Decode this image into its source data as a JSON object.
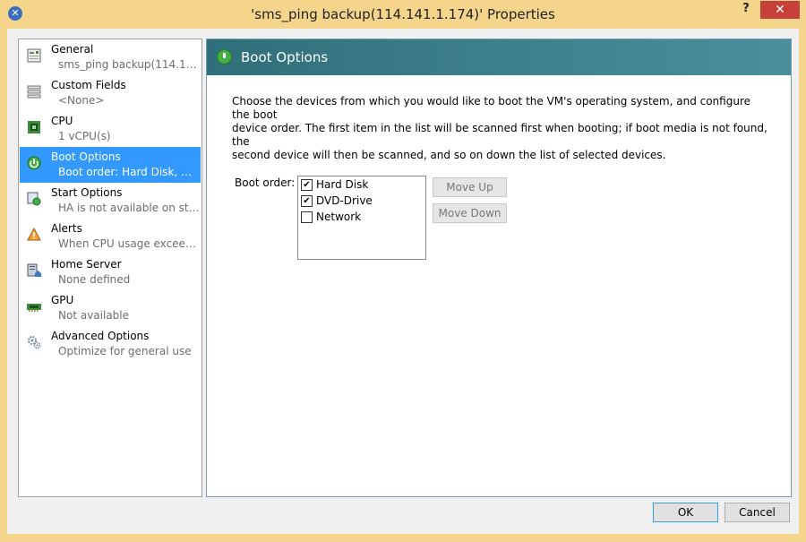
{
  "window": {
    "title": "'sms_ping backup(114.141.1.174)' Properties",
    "help_label": "?",
    "close_label": "✕"
  },
  "sidebar": {
    "items": [
      {
        "title": "General",
        "subtitle": "sms_ping backup(114.141...",
        "icon": "general-icon"
      },
      {
        "title": "Custom Fields",
        "subtitle": "<None>",
        "icon": "custom-fields-icon"
      },
      {
        "title": "CPU",
        "subtitle": "1 vCPU(s)",
        "icon": "cpu-icon"
      },
      {
        "title": "Boot Options",
        "subtitle": "Boot order: Hard Disk, DV...",
        "icon": "power-icon",
        "selected": true
      },
      {
        "title": "Start Options",
        "subtitle": "HA is not available on sta...",
        "icon": "start-options-icon"
      },
      {
        "title": "Alerts",
        "subtitle": "When CPU usage exceeds ...",
        "icon": "warning-icon"
      },
      {
        "title": "Home Server",
        "subtitle": "None defined",
        "icon": "home-server-icon"
      },
      {
        "title": "GPU",
        "subtitle": "Not available",
        "icon": "gpu-icon"
      },
      {
        "title": "Advanced Options",
        "subtitle": "Optimize for general use",
        "icon": "gears-icon"
      }
    ]
  },
  "content": {
    "header_title": "Boot Options",
    "description_lines": [
      "Choose the devices from which you would like to boot the VM's operating system, and configure the boot",
      "device order. The first item in the list will be scanned first when booting; if boot media is not found, the",
      "second device will then be scanned, and so on down the list of selected devices."
    ],
    "boot_order_label": "Boot order:",
    "boot_devices": [
      {
        "label": "Hard Disk",
        "checked": true
      },
      {
        "label": "DVD-Drive",
        "checked": true
      },
      {
        "label": "Network",
        "checked": false
      }
    ],
    "move_up_label": "Move Up",
    "move_down_label": "Move Down"
  },
  "footer": {
    "ok_label": "OK",
    "cancel_label": "Cancel"
  },
  "colors": {
    "selection": "#3399ff",
    "header_gradient_start": "#2f6f7a",
    "window_frame": "#f5d58c",
    "close_button": "#c7403a"
  }
}
